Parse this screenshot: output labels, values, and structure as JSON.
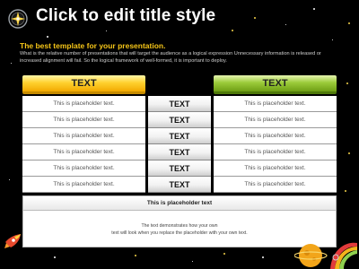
{
  "slide": {
    "title": "Click to edit title style",
    "subtitle": "The best template for your presentation.",
    "description": "What is the relative number of presentations that will target the audience as a logical expression Unnecessary information is released or increased alignment will fail. So the logical framework of well-formed, it is important to deploy."
  },
  "table": {
    "left_header": "TEXT",
    "right_header": "TEXT",
    "left_cells": [
      "This is placeholder text.",
      "This is placeholder text.",
      "This is placeholder text.",
      "This is placeholder text.",
      "This is placeholder text.",
      "This is placeholder text."
    ],
    "middle_cells": [
      "TEXT",
      "TEXT",
      "TEXT",
      "TEXT",
      "TEXT",
      "TEXT"
    ],
    "right_cells": [
      "This is placeholder text.",
      "This is placeholder text.",
      "This is placeholder text.",
      "This is placeholder text.",
      "This is placeholder text.",
      "This is placeholder text."
    ]
  },
  "bottom": {
    "heading": "This is placeholder text",
    "line1": "The text demonstrates how your own",
    "line2": "text will look when you replace the placeholder with your own text."
  },
  "colors": {
    "background": "#000000",
    "left_header": "#f2b400",
    "right_header": "#8dbb2e",
    "subtitle": "#f5c518"
  },
  "icons": {
    "title": "sparkle-icon",
    "rocket": "rocket-icon",
    "planet": "planet-icon"
  }
}
